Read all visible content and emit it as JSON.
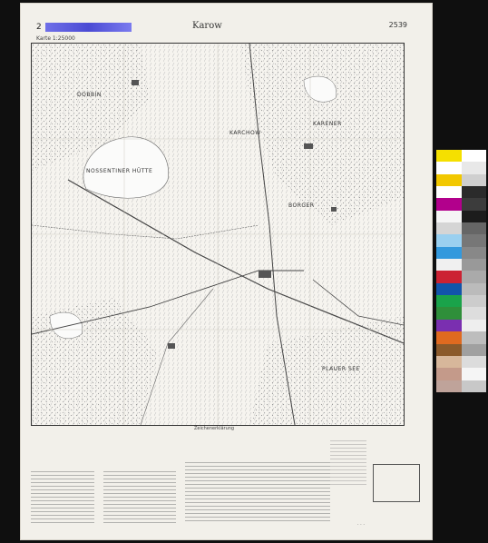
{
  "sheet": {
    "number_prefix": "2",
    "title": "Karow",
    "sheet_number": "2539",
    "subtitle": "Karte 1:25000"
  },
  "map_labels": [
    {
      "id": "label-1",
      "text": "DOBBIN"
    },
    {
      "id": "label-2",
      "text": "KARCHOW"
    },
    {
      "id": "label-3",
      "text": "NOSSENTINER HÜTTE"
    },
    {
      "id": "label-4",
      "text": "BORGER"
    },
    {
      "id": "label-5",
      "text": "KARENER"
    },
    {
      "id": "label-6",
      "text": "PLAUER SEE"
    }
  ],
  "legend": {
    "title": "Zeichenerklärung"
  },
  "color_chart": {
    "colors": [
      "#f5e000",
      "#ffffff",
      "#f2c800",
      "#ffffff",
      "#b2008c",
      "#f5f5f5",
      "#d5d5d5",
      "#9ad0f0",
      "#3399dd",
      "#f0f0f0",
      "#cc2233",
      "#1255aa",
      "#1aa34a",
      "#2f8f3a",
      "#7a2fb0",
      "#e06a20",
      "#8b5a2b",
      "#d7b79b",
      "#c49a8a",
      "#bfa39a"
    ],
    "grays": [
      "#ffffff",
      "#e8e8e8",
      "#cfcfcf",
      "#2b2b2b",
      "#3c3c3c",
      "#1c1c1c",
      "#666",
      "#777",
      "#888",
      "#999",
      "#aaa",
      "#bbb",
      "#ccc",
      "#ddd",
      "#eee",
      "#bdbdbd",
      "#a0a0a0",
      "#dcdcdc",
      "#f5f5f5",
      "#c8c8c8"
    ]
  }
}
